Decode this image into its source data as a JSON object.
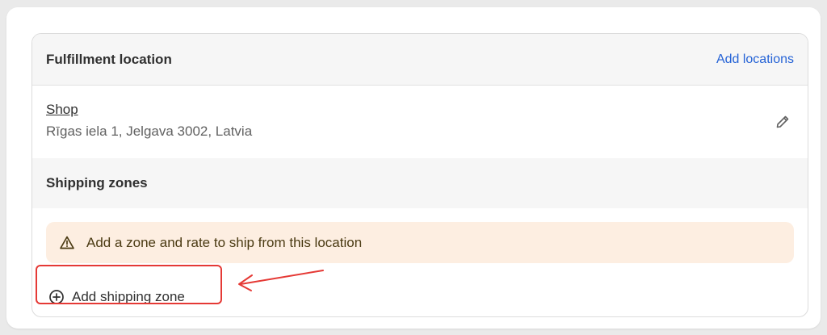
{
  "header": {
    "title": "Fulfillment location",
    "add_locations_label": "Add locations"
  },
  "location": {
    "name": "Shop",
    "address": "Rīgas iela 1, Jelgava 3002, Latvia",
    "edit_icon": "pencil-icon"
  },
  "shipping_zones": {
    "title": "Shipping zones",
    "warning": {
      "icon": "warning-triangle-icon",
      "text": "Add a zone and rate to ship from this location"
    },
    "add_zone": {
      "icon": "plus-circle-icon",
      "label": "Add shipping zone"
    }
  },
  "annotation": {
    "color": "#e53935",
    "arrow_icon": "arrow-left-icon"
  },
  "colors": {
    "link": "#2563d6",
    "warning_bg": "#fdeee1"
  }
}
